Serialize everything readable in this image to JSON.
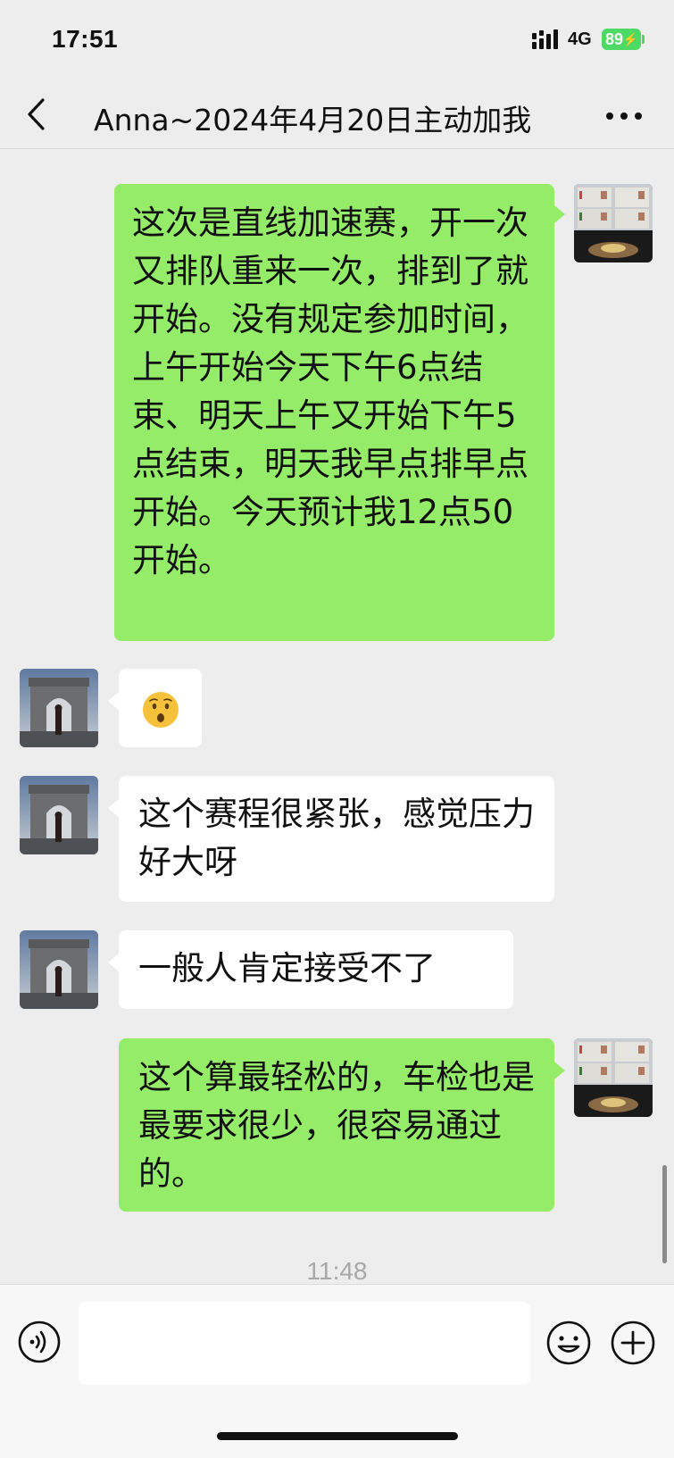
{
  "status_bar": {
    "time": "17:51",
    "network": "4G",
    "battery": "89"
  },
  "nav": {
    "title": "Anna~2024年4月20日主动加我"
  },
  "messages": [
    {
      "side": "out",
      "text": "这次是直线加速赛，开一次又排队重来一次，排到了就开始。没有规定参加时间，上午开始今天下午6点结束、明天上午又开始下午5点结束，明天我早点排早点开始。今天预计我12点50开始。"
    },
    {
      "side": "in",
      "emoji": "hushed-face-emoji"
    },
    {
      "side": "in",
      "text": "这个赛程很紧张，感觉压力好大呀"
    },
    {
      "side": "in",
      "text": "一般人肯定接受不了"
    },
    {
      "side": "out",
      "text": "这个算最轻松的，车检也是最要求很少，很容易通过的。"
    }
  ],
  "timestamp": "11:48",
  "input": {
    "value": "",
    "placeholder": ""
  },
  "icons": {
    "back": "chevron-left-icon",
    "more": "more-dots-icon",
    "voice": "voice-icon",
    "emoji": "emoji-icon",
    "plus": "plus-icon"
  },
  "colors": {
    "outgoing_bubble": "#95ec69",
    "incoming_bubble": "#ffffff",
    "background": "#ededed",
    "battery": "#4cd964"
  }
}
